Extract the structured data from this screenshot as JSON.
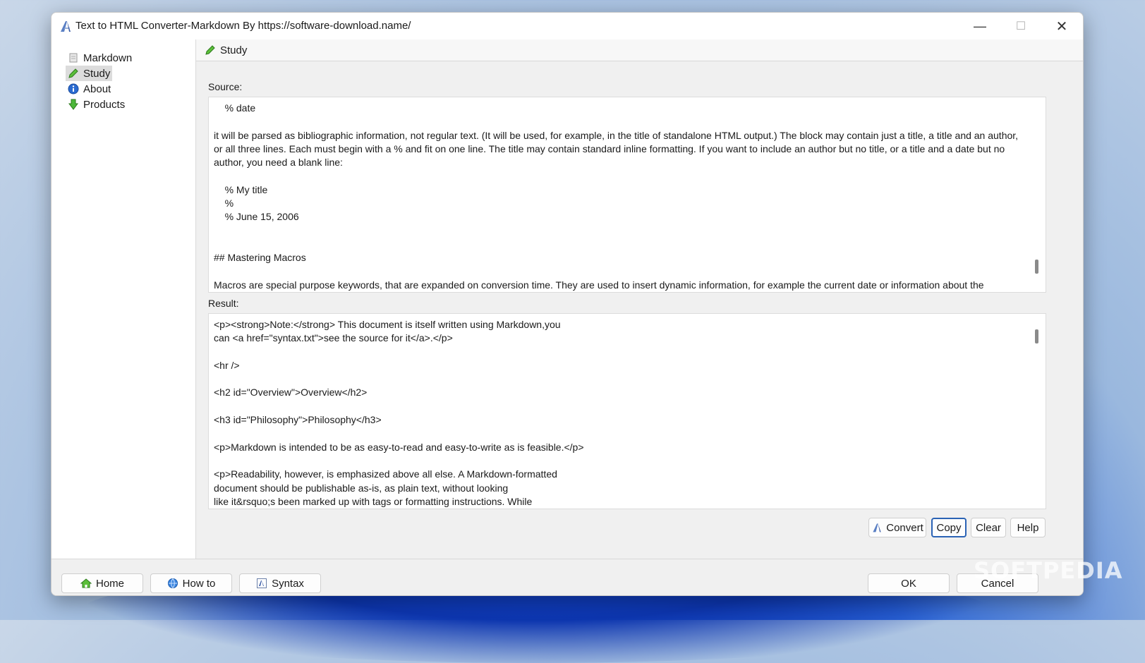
{
  "window": {
    "title": "Text to HTML Converter-Markdown By https://software-download.name/",
    "min_glyph": "—",
    "max_glyph": "☐",
    "close_glyph": "✕"
  },
  "sidebar": {
    "items": [
      {
        "label": "Markdown",
        "icon": "document-icon"
      },
      {
        "label": "Study",
        "icon": "pencil-icon",
        "active": true
      },
      {
        "label": "About",
        "icon": "info-icon"
      },
      {
        "label": "Products",
        "icon": "download-arrow-icon"
      }
    ]
  },
  "main": {
    "header": "Study",
    "source_label": "Source:",
    "source_text": "    % date\n\nit will be parsed as bibliographic information, not regular text. (It will be used, for example, in the title of standalone HTML output.) The block may contain just a title, a title and an author, or all three lines. Each must begin with a % and fit on one line. The title may contain standard inline formatting. If you want to include an author but no title, or a title and a date but no author, you need a blank line:\n\n    % My title\n    %\n    % June 15, 2006\n\n\n## Mastering Macros\n\nMacros are special purpose keywords, that are expanded on conversion time. They are used to insert dynamic information, for example the current date or information about the",
    "result_label": "Result:",
    "result_text": "<p><strong>Note:</strong> This document is itself written using Markdown,you\ncan <a href=\"syntax.txt\">see the source for it</a>.</p>\n\n<hr />\n\n<h2 id=\"Overview\">Overview</h2>\n\n<h3 id=\"Philosophy\">Philosophy</h3>\n\n<p>Markdown is intended to be as easy-to-read and easy-to-write as is feasible.</p>\n\n<p>Readability, however, is emphasized above all else. A Markdown-formatted\ndocument should be publishable as-is, as plain text, without looking\nlike it&rsquo;s been marked up with tags or formatting instructions. While",
    "actions": {
      "convert": "Convert",
      "copy": "Copy",
      "clear": "Clear",
      "help": "Help"
    }
  },
  "footer": {
    "home": "Home",
    "howto": "How to",
    "syntax": "Syntax",
    "ok": "OK",
    "cancel": "Cancel"
  },
  "watermark": "SOFTPEDIA",
  "colors": {
    "accent": "#2b63b5",
    "pencil": "#3a9a2a",
    "info": "#1f5fbf",
    "arrow": "#3aa63a"
  }
}
